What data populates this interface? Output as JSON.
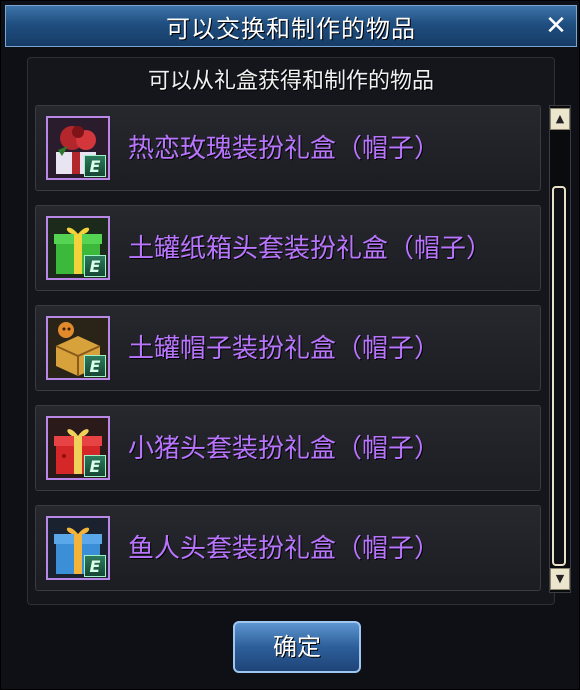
{
  "window": {
    "title": "可以交换和制作的物品",
    "close_symbol": "✕",
    "subtitle": "可以从礼盒获得和制作的物品",
    "ok_label": "确定"
  },
  "items": [
    {
      "label": "热恋玫瑰装扮礼盒（帽子）",
      "icon": "rose-gift-icon",
      "badge": "E",
      "primary_color": "#b3262b",
      "accent_color": "#e9e4f2"
    },
    {
      "label": "土罐纸箱头套装扮礼盒（帽子）",
      "icon": "green-gift-icon",
      "badge": "E",
      "primary_color": "#3cb83a",
      "accent_color": "#f3d23c"
    },
    {
      "label": "土罐帽子装扮礼盒（帽子）",
      "icon": "basket-gift-icon",
      "badge": "E",
      "primary_color": "#d7a13c",
      "accent_color": "#8a5a1c"
    },
    {
      "label": "小猪头套装扮礼盒（帽子）",
      "icon": "red-gift-icon",
      "badge": "E",
      "primary_color": "#d62728",
      "accent_color": "#f0d25a"
    },
    {
      "label": "鱼人头套装扮礼盒（帽子）",
      "icon": "blue-gift-icon",
      "badge": "E",
      "primary_color": "#3a8fd6",
      "accent_color": "#f4b43c"
    }
  ],
  "scrollbar": {
    "up": "▲",
    "down": "▼"
  },
  "colors": {
    "item_text": "#b975ff",
    "title_bar": "#1f4e80"
  }
}
